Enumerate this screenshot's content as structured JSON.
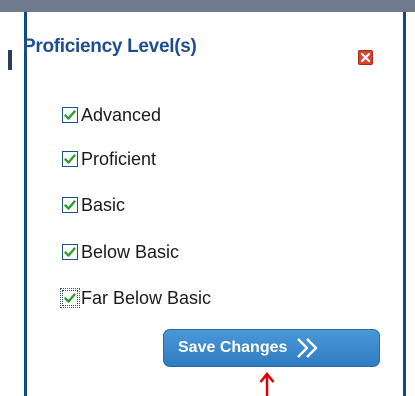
{
  "panel": {
    "title": "Proficiency Level(s)",
    "close_icon": "close-x-icon",
    "accent_color": "#1d4f8e",
    "close_color": "#d9442b"
  },
  "options": [
    {
      "label": "Advanced",
      "checked": true
    },
    {
      "label": "Proficient",
      "checked": true
    },
    {
      "label": "Basic",
      "checked": true
    },
    {
      "label": "Below Basic",
      "checked": true
    },
    {
      "label": "Far Below Basic",
      "checked": true,
      "focused": true
    }
  ],
  "save_button": {
    "label": "Save Changes",
    "icon": "double-chevron-right-icon",
    "color": "#3a88cf"
  },
  "annotation": {
    "icon": "red-up-arrow-icon",
    "color": "#e00000"
  }
}
